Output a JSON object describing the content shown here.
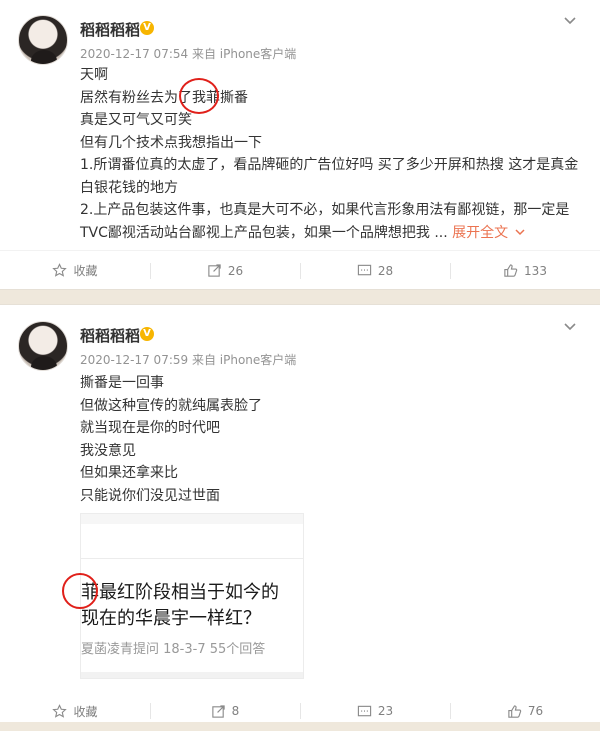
{
  "posts": [
    {
      "author": "稻稻稻稻",
      "verified_badge": "V",
      "timestamp": "2020-12-17 07:54",
      "source": "来自 iPhone客户端",
      "lines": [
        "天啊",
        "居然有粉丝去为了我菲撕番",
        "真是又可气又可笑",
        "但有几个技术点我想指出一下",
        "1.所谓番位真的太虚了，看品牌砸的广告位好吗 买了多少开屏和热搜 这才是真金白银花钱的地方",
        "2.上产品包装这件事，也真是大可不必，如果代言形象用法有鄙视链，那一定是TVC鄙视活动站台鄙视上产品包装，如果一个品牌想把我 ..."
      ],
      "expand_label": "展开全文",
      "actions": {
        "favorite": "收藏",
        "repost": "26",
        "comment": "28",
        "like": "133"
      }
    },
    {
      "author": "稻稻稻稻",
      "verified_badge": "V",
      "timestamp": "2020-12-17 07:59",
      "source": "来自 iPhone客户端",
      "lines": [
        "撕番是一回事",
        "但做这种宣传的就纯属表脸了",
        "就当现在是你的时代吧",
        "我没意见",
        "但如果还拿来比",
        "只能说你们没见过世面"
      ],
      "embed": {
        "title_line1": "菲最红阶段相当于如今的",
        "title_line2": "现在的华晨宇一样红？",
        "meta": "夏菡凌青提问 18-3-7  55个回答"
      },
      "actions": {
        "favorite": "收藏",
        "repost": "8",
        "comment": "23",
        "like": "76"
      }
    }
  ],
  "colors": {
    "expand": "#eb7350",
    "annotation": "#e0201a",
    "verified": "#f7b500"
  }
}
